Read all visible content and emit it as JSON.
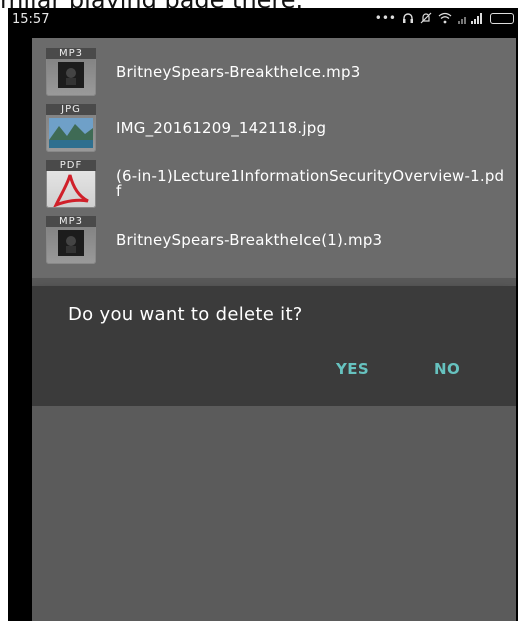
{
  "caption": {
    "text": "milar playing page there."
  },
  "statusbar": {
    "time": "15:57",
    "icons": [
      "more-dots-icon",
      "headset-icon",
      "mute-icon",
      "wifi-icon",
      "signal-icon",
      "battery-icon"
    ]
  },
  "files": [
    {
      "ext": "MP3",
      "name": "BritneySpears-BreaktheIce.mp3",
      "thumb": "music-thumb-icon"
    },
    {
      "ext": "JPG",
      "name": "IMG_20161209_142118.jpg",
      "thumb": "landscape-photo-thumb"
    },
    {
      "ext": "PDF",
      "name": "(6-in-1)Lecture1InformationSecurityOverview-1.pdf",
      "thumb": "pdf-logo-icon"
    },
    {
      "ext": "MP3",
      "name": "BritneySpears-BreaktheIce(1).mp3",
      "thumb": "music-thumb-icon"
    }
  ],
  "dialog": {
    "message": "Do you want to delete it?",
    "yes_label": "YES",
    "no_label": "NO"
  },
  "colors": {
    "accent": "#66c2bf",
    "dialog_bg": "#3b3b3b",
    "list_bg": "#6b6b6b",
    "screen_bg": "#595959"
  }
}
